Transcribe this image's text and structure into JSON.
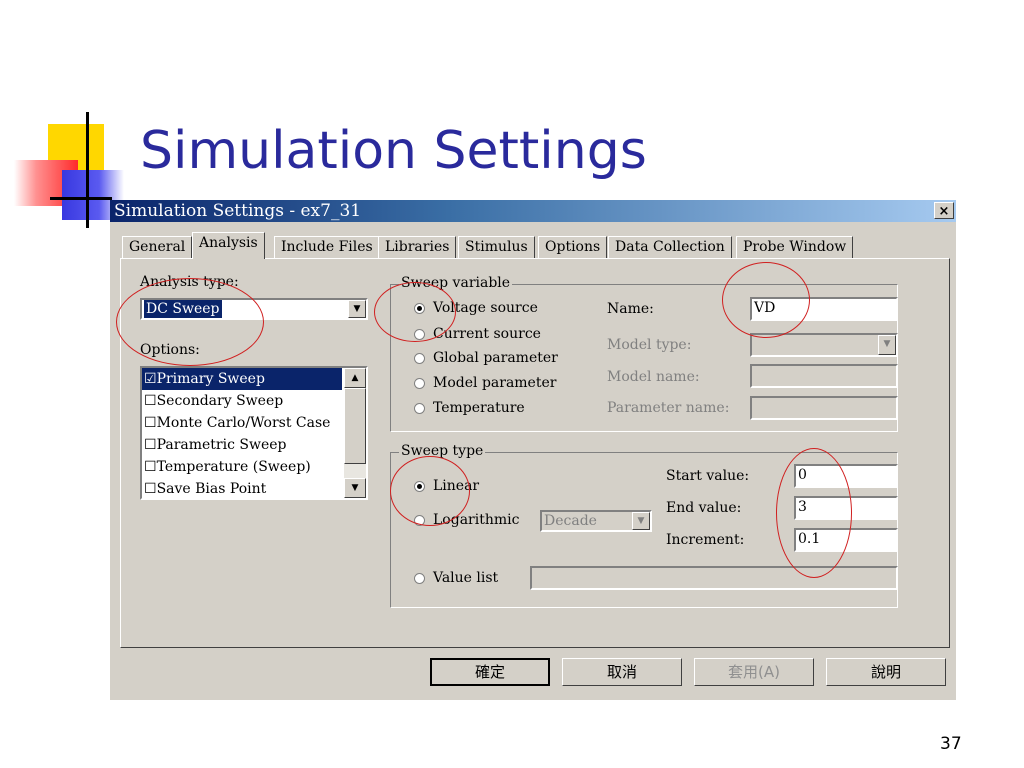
{
  "slide": {
    "title": "Simulation Settings",
    "page_number": "37"
  },
  "window": {
    "title": "Simulation Settings - ex7_31",
    "close_glyph": "×"
  },
  "tabs": [
    {
      "label": "General"
    },
    {
      "label": "Analysis"
    },
    {
      "label": "Include Files"
    },
    {
      "label": "Libraries"
    },
    {
      "label": "Stimulus"
    },
    {
      "label": "Options"
    },
    {
      "label": "Data Collection"
    },
    {
      "label": "Probe Window"
    }
  ],
  "analysis": {
    "type_label": "Analysis type:",
    "type_value": "DC Sweep"
  },
  "options": {
    "label": "Options:",
    "items": [
      {
        "label": "Primary Sweep",
        "checked": true
      },
      {
        "label": "Secondary Sweep",
        "checked": false
      },
      {
        "label": "Monte Carlo/Worst Case",
        "checked": false
      },
      {
        "label": "Parametric Sweep",
        "checked": false
      },
      {
        "label": "Temperature (Sweep)",
        "checked": false
      },
      {
        "label": "Save Bias Point",
        "checked": false
      }
    ],
    "check_on": "☑",
    "check_off": "☐"
  },
  "sweep_variable": {
    "title": "Sweep variable",
    "radios": [
      "Voltage source",
      "Current source",
      "Global parameter",
      "Model parameter",
      "Temperature"
    ],
    "name_label": "Name:",
    "name_value": "VD",
    "model_type_label": "Model type:",
    "model_name_label": "Model name:",
    "parameter_name_label": "Parameter name:"
  },
  "sweep_type": {
    "title": "Sweep type",
    "linear_label": "Linear",
    "log_label": "Logarithmic",
    "log_select": "Decade",
    "start_label": "Start value:",
    "start_value": "0",
    "end_label": "End value:",
    "end_value": "3",
    "increment_label": "Increment:",
    "increment_value": "0.1",
    "value_list_label": "Value list"
  },
  "buttons": {
    "ok": "確定",
    "cancel": "取消",
    "apply": "套用(A)",
    "help": "說明"
  },
  "colors": {
    "title": "#2a2a9c",
    "titlebar": "#0a246a",
    "dialog": "#d4d0c8",
    "annotation": "#d02020"
  }
}
